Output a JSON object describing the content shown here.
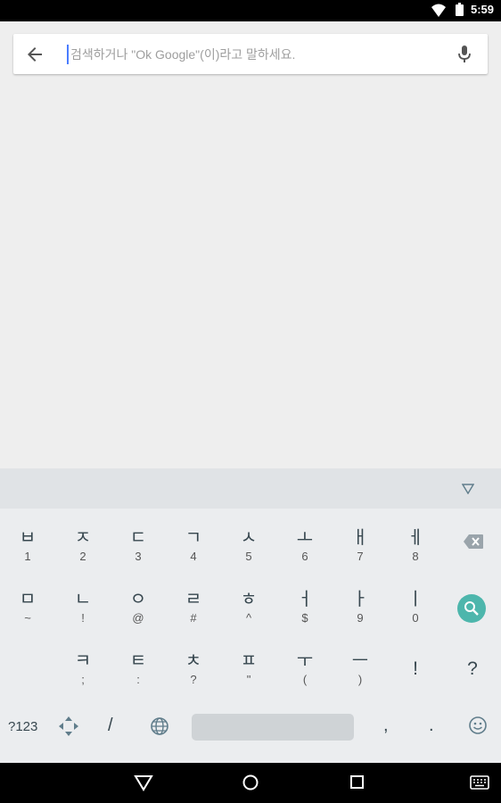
{
  "status_bar": {
    "time": "5:59"
  },
  "search": {
    "placeholder": "검색하거나 \"Ok Google\"(이)라고 말하세요.",
    "value": ""
  },
  "keyboard": {
    "row1": [
      {
        "main": "ㅂ",
        "sub": "1"
      },
      {
        "main": "ㅈ",
        "sub": "2"
      },
      {
        "main": "ㄷ",
        "sub": "3"
      },
      {
        "main": "ㄱ",
        "sub": "4"
      },
      {
        "main": "ㅅ",
        "sub": "5"
      },
      {
        "main": "ㅗ",
        "sub": "6"
      },
      {
        "main": "ㅐ",
        "sub": "7"
      },
      {
        "main": "ㅔ",
        "sub": "8"
      }
    ],
    "row2": [
      {
        "main": "ㅁ",
        "sub": "~"
      },
      {
        "main": "ㄴ",
        "sub": "!"
      },
      {
        "main": "ㅇ",
        "sub": "@"
      },
      {
        "main": "ㄹ",
        "sub": "#"
      },
      {
        "main": "ㅎ",
        "sub": "^"
      },
      {
        "main": "ㅓ",
        "sub": "$"
      },
      {
        "main": "ㅏ",
        "sub": "9"
      },
      {
        "main": "ㅣ",
        "sub": "0"
      }
    ],
    "row3": [
      {
        "main": "ㅋ",
        "sub": ";"
      },
      {
        "main": "ㅌ",
        "sub": ":"
      },
      {
        "main": "ㅊ",
        "sub": "?"
      },
      {
        "main": "ㅍ",
        "sub": "\""
      },
      {
        "main": "ㅜ",
        "sub": "("
      },
      {
        "main": "ㅡ",
        "sub": ")"
      }
    ],
    "row3_extra": [
      "!",
      "?"
    ],
    "bottom": {
      "symbols_label": "?123",
      "slash": "/",
      "comma": ",",
      "period": "."
    },
    "accent_color": "#4db6ac"
  },
  "icons": [
    "back-arrow-icon",
    "mic-icon",
    "collapse-keyboard-icon",
    "backspace-icon",
    "search-icon",
    "cursor-move-icon",
    "globe-icon",
    "emoji-icon",
    "nav-back-icon",
    "nav-home-icon",
    "nav-recents-icon",
    "keyboard-switch-icon",
    "wifi-icon",
    "battery-icon"
  ]
}
